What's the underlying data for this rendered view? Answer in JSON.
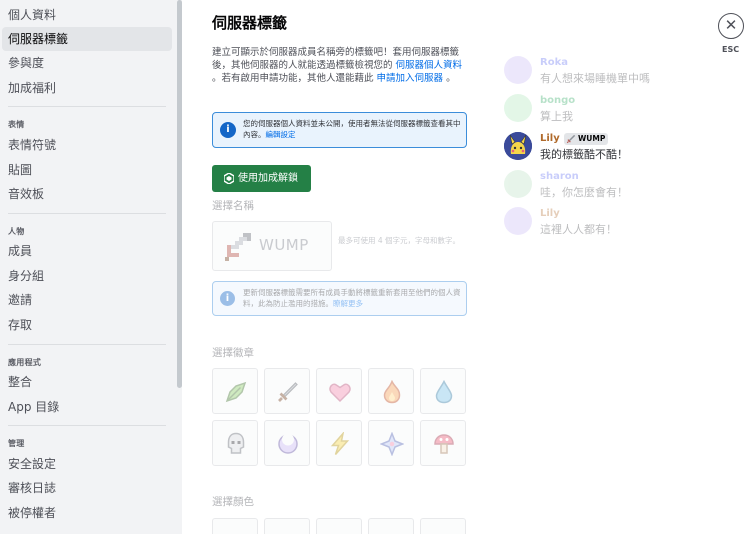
{
  "sidebar": {
    "items_top": [
      {
        "label": "個人資料"
      },
      {
        "label": "伺服器標籤"
      },
      {
        "label": "參與度"
      },
      {
        "label": "加成福利"
      }
    ],
    "section_emoji": {
      "header": "表情",
      "items": [
        {
          "label": "表情符號"
        },
        {
          "label": "貼圖"
        },
        {
          "label": "音效板"
        }
      ]
    },
    "section_people": {
      "header": "人物",
      "items": [
        {
          "label": "成員"
        },
        {
          "label": "身分組"
        },
        {
          "label": "邀請"
        },
        {
          "label": "存取"
        }
      ]
    },
    "section_apps": {
      "header": "應用程式",
      "items": [
        {
          "label": "整合"
        },
        {
          "label": "App 目錄"
        }
      ]
    },
    "section_mod": {
      "header": "管理",
      "items": [
        {
          "label": "安全設定"
        },
        {
          "label": "審核日誌"
        },
        {
          "label": "被停權者"
        }
      ]
    }
  },
  "main": {
    "title": "伺服器標籤",
    "description": {
      "part1": "建立可顯示於伺服器成員名稱旁的標籤吧！套用伺服器標籤後，其他伺服器的人就能透過標籤檢視您的",
      "link1": "伺服器個人資料",
      "part2": "。若有啟用申請功能，其他人還能藉此",
      "link2": "申請加入伺服器",
      "part3": "。"
    },
    "notice": {
      "text": "您的伺服器個人資料並未公開，使用者無法從伺服器標籤查看其中內容。",
      "link": "編輯設定"
    },
    "boost_button": "使用加成解鎖",
    "choose_name_label": "選擇名稱",
    "tag_value": "WUMP",
    "tag_hint": "最多可使用 4 個字元，字母和數字。",
    "notice2": {
      "text": "更新伺服器標籤需要所有成員手動將標籤重新套用至他們的個人資料，此為防止濫用的措施。",
      "link": "瞭解更多"
    },
    "choose_badge_label": "選擇徽章",
    "choose_color_label": "選擇顏色",
    "badges": [
      "leaf-icon",
      "sword-icon",
      "heart-icon",
      "fire-icon",
      "water-drop-icon",
      "skull-icon",
      "moon-icon",
      "lightning-icon",
      "sparkle-icon",
      "mushroom-icon"
    ]
  },
  "preview": {
    "messages": [
      {
        "name": "Roka",
        "text": "有人想來場睡機單中嗎",
        "color": "#5865f2"
      },
      {
        "name": "bongo",
        "text": "算上我",
        "color": "#23a55a"
      },
      {
        "name": "Lily",
        "tag": "WUMP",
        "text": "我的標籤酷不酷！",
        "color": "#b06a2b"
      },
      {
        "name": "sharon",
        "text": "哇，你怎麼會有！",
        "color": "#5865f2"
      },
      {
        "name": "Lily",
        "text": "這裡人人都有！",
        "color": "#b06a2b"
      }
    ]
  },
  "close": {
    "label": "ESC"
  },
  "colors": {
    "accent_green": "#248046",
    "link_blue": "#006ce7",
    "sidebar_bg": "#f2f3f5"
  }
}
